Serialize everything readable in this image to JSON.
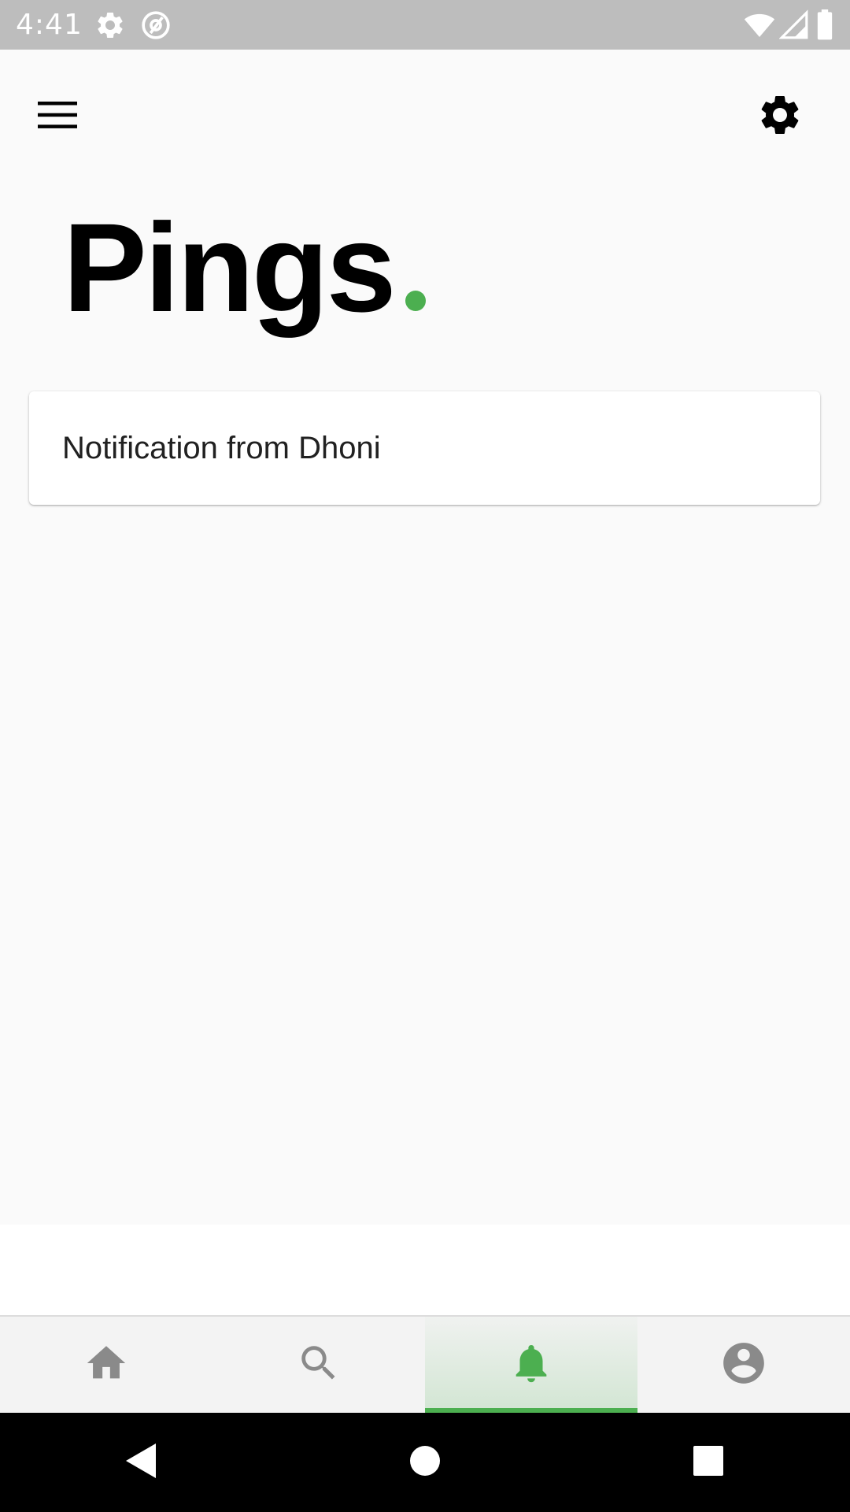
{
  "status_bar": {
    "time": "4:41",
    "left_icons": [
      "gear-icon",
      "at-sign-icon"
    ],
    "right_icons": [
      "wifi-icon",
      "cellular-signal-icon",
      "battery-icon"
    ]
  },
  "app_bar": {
    "menu_icon": "hamburger-menu-icon",
    "settings_icon": "gear-icon"
  },
  "page": {
    "title": "Pings",
    "accent_color": "#4caf50"
  },
  "notifications": [
    {
      "text": "Notification from Dhoni"
    }
  ],
  "bottom_nav": {
    "items": [
      {
        "name": "home",
        "icon": "home-icon",
        "active": false
      },
      {
        "name": "search",
        "icon": "search-icon",
        "active": false
      },
      {
        "name": "notifications",
        "icon": "bell-icon",
        "active": true
      },
      {
        "name": "profile",
        "icon": "account-circle-icon",
        "active": false
      }
    ],
    "active_color": "#4caf50",
    "inactive_color": "#8a8a8a"
  },
  "system_nav": {
    "buttons": [
      "back-icon",
      "home-circle-icon",
      "recents-square-icon"
    ]
  }
}
